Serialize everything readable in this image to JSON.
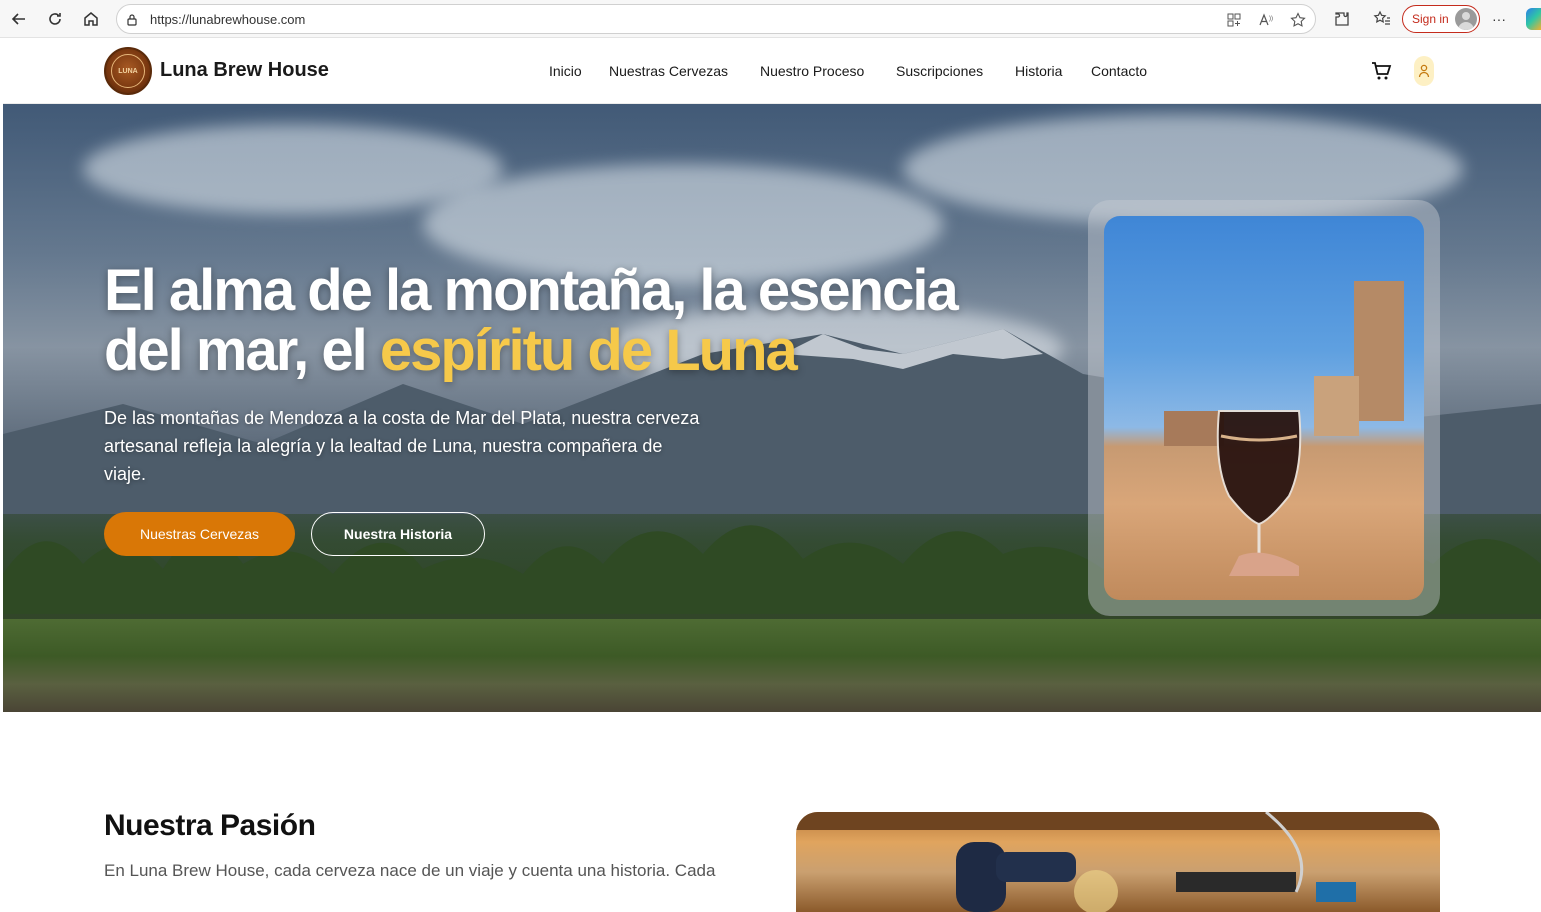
{
  "browser": {
    "url": "https://lunabrewhouse.com",
    "sign_in_label": "Sign in",
    "more_label": "···"
  },
  "header": {
    "logo_text": "LUNA",
    "brand": "Luna Brew House",
    "nav": [
      "Inicio",
      "Nuestras Cervezas",
      "Nuestro Proceso",
      "Suscripciones",
      "Historia",
      "Contacto"
    ],
    "cart_icon": "cart-icon",
    "user_icon": "user-icon"
  },
  "hero": {
    "title_main": "El alma de la montaña, la esencia del mar, el ",
    "title_highlight": "espíritu de Luna",
    "subtitle": "De las montañas de Mendoza a la costa de Mar del Plata, nuestra cerveza artesanal refleja la alegría y la lealtad de Luna, nuestra compañera de viaje.",
    "primary_button": "Nuestras Cervezas",
    "secondary_button": "Nuestra Historia",
    "accent_color": "#d97706",
    "highlight_color": "#f6c94a"
  },
  "section": {
    "title": "Nuestra Pasión",
    "text": "En Luna Brew House, cada cerveza nace de un viaje y cuenta una historia. Cada"
  }
}
